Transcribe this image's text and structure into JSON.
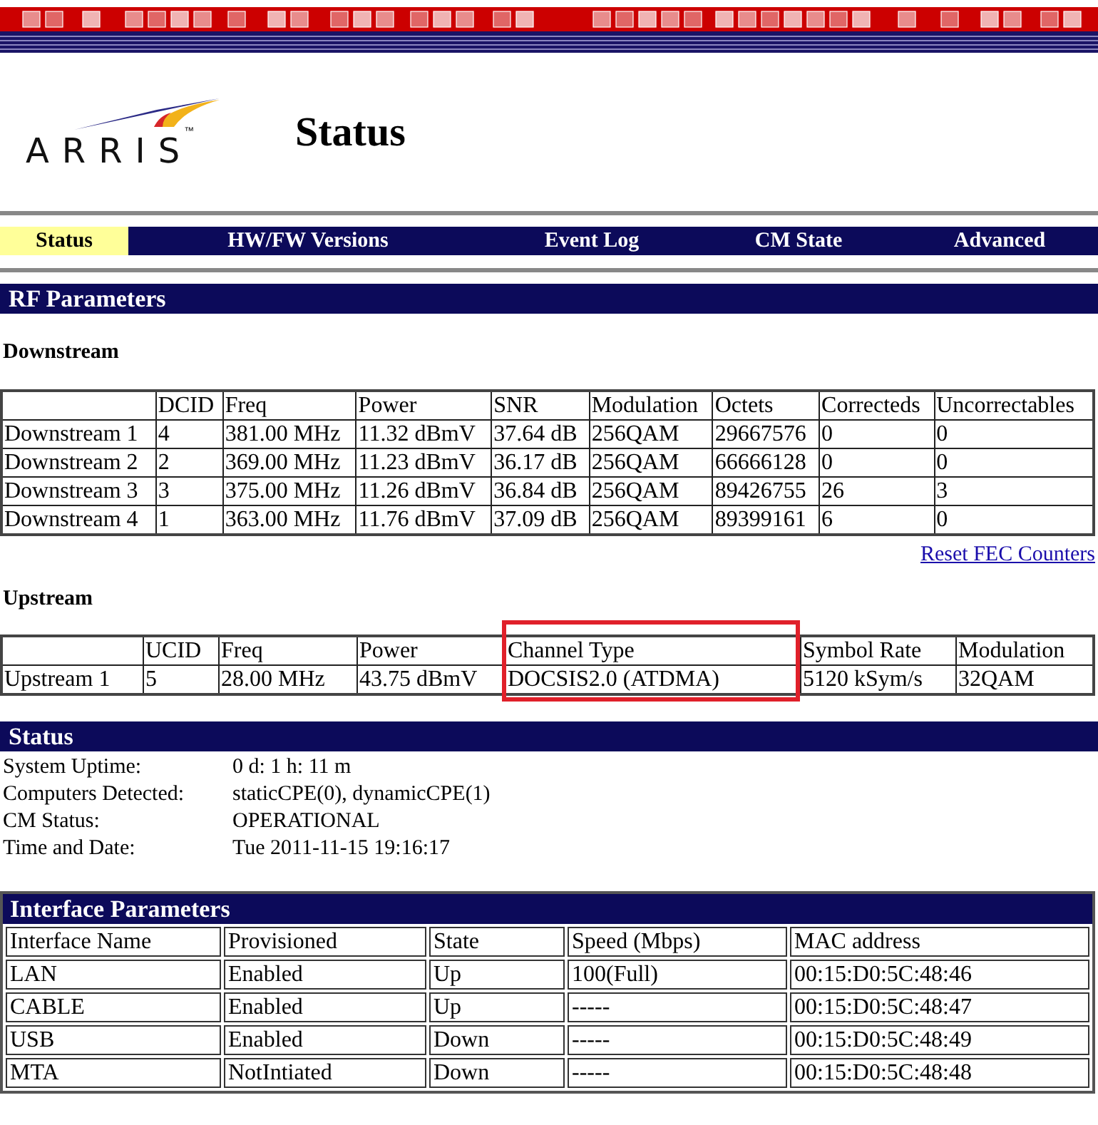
{
  "logo": {
    "text": "ARRIS",
    "mark": "™"
  },
  "page_title": "Status",
  "tabs": [
    {
      "label": "Status",
      "selected": true
    },
    {
      "label": "HW/FW Versions",
      "selected": false
    },
    {
      "label": "Event Log",
      "selected": false
    },
    {
      "label": "CM State",
      "selected": false
    },
    {
      "label": "Advanced",
      "selected": false
    }
  ],
  "rf_parameters": {
    "title": "RF Parameters",
    "downstream": {
      "heading": "Downstream",
      "columns": [
        "DCID",
        "Freq",
        "Power",
        "SNR",
        "Modulation",
        "Octets",
        "Correcteds",
        "Uncorrectables"
      ],
      "rows": [
        {
          "channel": "Downstream 1",
          "values": [
            "4",
            "381.00 MHz",
            "11.32 dBmV",
            "37.64 dB",
            "256QAM",
            "29667576",
            "0",
            "0"
          ]
        },
        {
          "channel": "Downstream 2",
          "values": [
            "2",
            "369.00 MHz",
            "11.23 dBmV",
            "36.17 dB",
            "256QAM",
            "66666128",
            "0",
            "0"
          ]
        },
        {
          "channel": "Downstream 3",
          "values": [
            "3",
            "375.00 MHz",
            "11.26 dBmV",
            "36.84 dB",
            "256QAM",
            "89426755",
            "26",
            "3"
          ]
        },
        {
          "channel": "Downstream 4",
          "values": [
            "1",
            "363.00 MHz",
            "11.76 dBmV",
            "37.09 dB",
            "256QAM",
            "89399161",
            "6",
            "0"
          ]
        }
      ],
      "reset_link": "Reset FEC Counters"
    },
    "upstream": {
      "heading": "Upstream",
      "columns": [
        {
          "label": "UCID",
          "highlighted": false
        },
        {
          "label": "Freq",
          "highlighted": false
        },
        {
          "label": "Power",
          "highlighted": false
        },
        {
          "label": "Channel Type",
          "highlighted": true
        },
        {
          "label": "Symbol Rate",
          "highlighted": false
        },
        {
          "label": "Modulation",
          "highlighted": false
        }
      ],
      "rows": [
        {
          "channel": "Upstream 1",
          "values": [
            "5",
            "28.00 MHz",
            "43.75 dBmV",
            "DOCSIS2.0 (ATDMA)",
            "5120 kSym/s",
            "32QAM"
          ]
        }
      ]
    }
  },
  "status": {
    "title": "Status",
    "fields": [
      {
        "label": "System Uptime:",
        "value": "0 d: 1 h: 11 m"
      },
      {
        "label": "Computers Detected:",
        "value": "staticCPE(0), dynamicCPE(1)"
      },
      {
        "label": "CM Status:",
        "value": "OPERATIONAL"
      },
      {
        "label": "Time and Date:",
        "value": "Tue 2011-11-15 19:16:17"
      }
    ]
  },
  "interface_parameters": {
    "title": "Interface Parameters",
    "columns": [
      "Interface Name",
      "Provisioned",
      "State",
      "Speed (Mbps)",
      "MAC address"
    ],
    "rows": [
      [
        "LAN",
        "Enabled",
        "Up",
        "100(Full)",
        "00:15:D0:5C:48:46"
      ],
      [
        "CABLE",
        "Enabled",
        "Up",
        "-----",
        "00:15:D0:5C:48:47"
      ],
      [
        "USB",
        "Enabled",
        "Down",
        "-----",
        "00:15:D0:5C:48:49"
      ],
      [
        "MTA",
        "NotIntiated",
        "Down",
        "-----",
        "00:15:D0:5C:48:48"
      ]
    ]
  }
}
